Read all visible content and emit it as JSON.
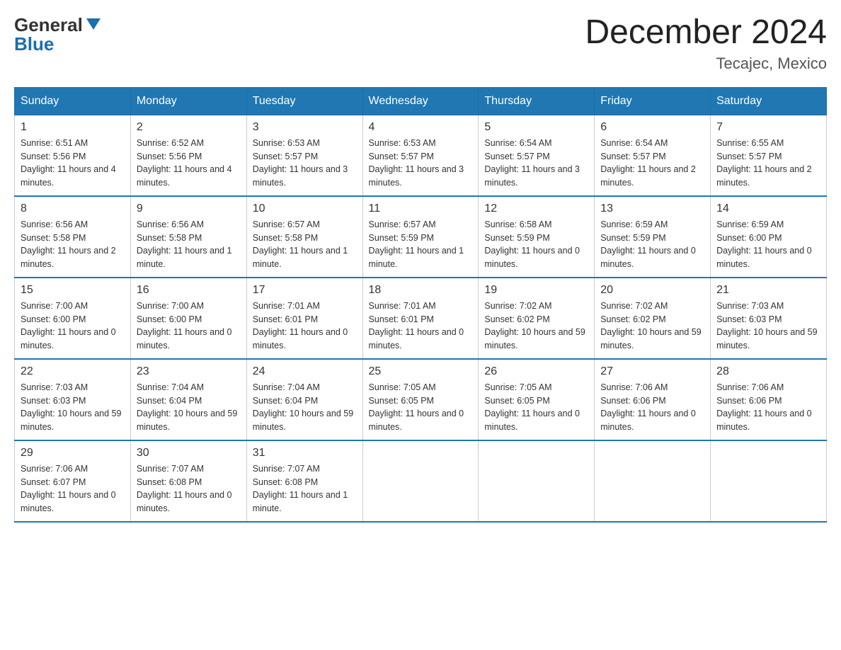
{
  "header": {
    "logo_general": "General",
    "logo_blue": "Blue",
    "month_title": "December 2024",
    "location": "Tecajec, Mexico"
  },
  "weekdays": [
    "Sunday",
    "Monday",
    "Tuesday",
    "Wednesday",
    "Thursday",
    "Friday",
    "Saturday"
  ],
  "weeks": [
    [
      {
        "day": "1",
        "sunrise": "6:51 AM",
        "sunset": "5:56 PM",
        "daylight": "11 hours and 4 minutes."
      },
      {
        "day": "2",
        "sunrise": "6:52 AM",
        "sunset": "5:56 PM",
        "daylight": "11 hours and 4 minutes."
      },
      {
        "day": "3",
        "sunrise": "6:53 AM",
        "sunset": "5:57 PM",
        "daylight": "11 hours and 3 minutes."
      },
      {
        "day": "4",
        "sunrise": "6:53 AM",
        "sunset": "5:57 PM",
        "daylight": "11 hours and 3 minutes."
      },
      {
        "day": "5",
        "sunrise": "6:54 AM",
        "sunset": "5:57 PM",
        "daylight": "11 hours and 3 minutes."
      },
      {
        "day": "6",
        "sunrise": "6:54 AM",
        "sunset": "5:57 PM",
        "daylight": "11 hours and 2 minutes."
      },
      {
        "day": "7",
        "sunrise": "6:55 AM",
        "sunset": "5:57 PM",
        "daylight": "11 hours and 2 minutes."
      }
    ],
    [
      {
        "day": "8",
        "sunrise": "6:56 AM",
        "sunset": "5:58 PM",
        "daylight": "11 hours and 2 minutes."
      },
      {
        "day": "9",
        "sunrise": "6:56 AM",
        "sunset": "5:58 PM",
        "daylight": "11 hours and 1 minute."
      },
      {
        "day": "10",
        "sunrise": "6:57 AM",
        "sunset": "5:58 PM",
        "daylight": "11 hours and 1 minute."
      },
      {
        "day": "11",
        "sunrise": "6:57 AM",
        "sunset": "5:59 PM",
        "daylight": "11 hours and 1 minute."
      },
      {
        "day": "12",
        "sunrise": "6:58 AM",
        "sunset": "5:59 PM",
        "daylight": "11 hours and 0 minutes."
      },
      {
        "day": "13",
        "sunrise": "6:59 AM",
        "sunset": "5:59 PM",
        "daylight": "11 hours and 0 minutes."
      },
      {
        "day": "14",
        "sunrise": "6:59 AM",
        "sunset": "6:00 PM",
        "daylight": "11 hours and 0 minutes."
      }
    ],
    [
      {
        "day": "15",
        "sunrise": "7:00 AM",
        "sunset": "6:00 PM",
        "daylight": "11 hours and 0 minutes."
      },
      {
        "day": "16",
        "sunrise": "7:00 AM",
        "sunset": "6:00 PM",
        "daylight": "11 hours and 0 minutes."
      },
      {
        "day": "17",
        "sunrise": "7:01 AM",
        "sunset": "6:01 PM",
        "daylight": "11 hours and 0 minutes."
      },
      {
        "day": "18",
        "sunrise": "7:01 AM",
        "sunset": "6:01 PM",
        "daylight": "11 hours and 0 minutes."
      },
      {
        "day": "19",
        "sunrise": "7:02 AM",
        "sunset": "6:02 PM",
        "daylight": "10 hours and 59 minutes."
      },
      {
        "day": "20",
        "sunrise": "7:02 AM",
        "sunset": "6:02 PM",
        "daylight": "10 hours and 59 minutes."
      },
      {
        "day": "21",
        "sunrise": "7:03 AM",
        "sunset": "6:03 PM",
        "daylight": "10 hours and 59 minutes."
      }
    ],
    [
      {
        "day": "22",
        "sunrise": "7:03 AM",
        "sunset": "6:03 PM",
        "daylight": "10 hours and 59 minutes."
      },
      {
        "day": "23",
        "sunrise": "7:04 AM",
        "sunset": "6:04 PM",
        "daylight": "10 hours and 59 minutes."
      },
      {
        "day": "24",
        "sunrise": "7:04 AM",
        "sunset": "6:04 PM",
        "daylight": "10 hours and 59 minutes."
      },
      {
        "day": "25",
        "sunrise": "7:05 AM",
        "sunset": "6:05 PM",
        "daylight": "11 hours and 0 minutes."
      },
      {
        "day": "26",
        "sunrise": "7:05 AM",
        "sunset": "6:05 PM",
        "daylight": "11 hours and 0 minutes."
      },
      {
        "day": "27",
        "sunrise": "7:06 AM",
        "sunset": "6:06 PM",
        "daylight": "11 hours and 0 minutes."
      },
      {
        "day": "28",
        "sunrise": "7:06 AM",
        "sunset": "6:06 PM",
        "daylight": "11 hours and 0 minutes."
      }
    ],
    [
      {
        "day": "29",
        "sunrise": "7:06 AM",
        "sunset": "6:07 PM",
        "daylight": "11 hours and 0 minutes."
      },
      {
        "day": "30",
        "sunrise": "7:07 AM",
        "sunset": "6:08 PM",
        "daylight": "11 hours and 0 minutes."
      },
      {
        "day": "31",
        "sunrise": "7:07 AM",
        "sunset": "6:08 PM",
        "daylight": "11 hours and 1 minute."
      },
      null,
      null,
      null,
      null
    ]
  ],
  "labels": {
    "sunrise": "Sunrise:",
    "sunset": "Sunset:",
    "daylight": "Daylight:"
  },
  "colors": {
    "header_bg": "#2077b2",
    "border_blue": "#2077b2"
  }
}
